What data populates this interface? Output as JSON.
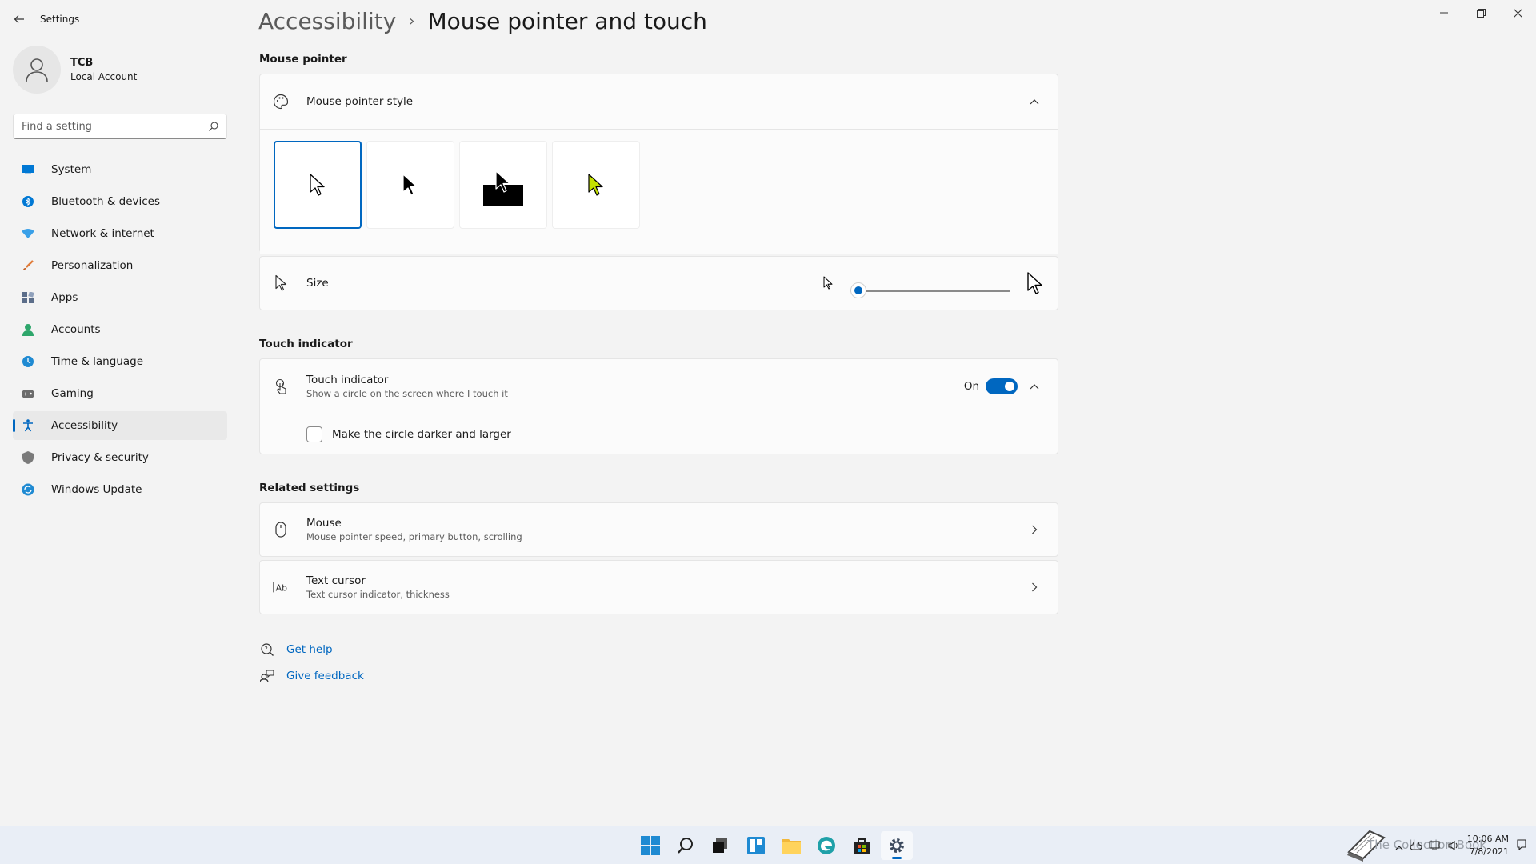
{
  "app": {
    "title": "Settings"
  },
  "user": {
    "name": "TCB",
    "account_type": "Local Account"
  },
  "search": {
    "placeholder": "Find a setting"
  },
  "nav": {
    "items": [
      {
        "label": "System",
        "icon": "monitor-icon",
        "color": "#0078d4"
      },
      {
        "label": "Bluetooth & devices",
        "icon": "bluetooth-icon",
        "color": "#0078d4"
      },
      {
        "label": "Network & internet",
        "icon": "wifi-icon",
        "color": "#3aa0e8"
      },
      {
        "label": "Personalization",
        "icon": "brush-icon",
        "color": "#e07b39"
      },
      {
        "label": "Apps",
        "icon": "apps-icon",
        "color": "#5c6e8a"
      },
      {
        "label": "Accounts",
        "icon": "person-icon",
        "color": "#2ea66b"
      },
      {
        "label": "Time & language",
        "icon": "globe-icon",
        "color": "#1f8ad2"
      },
      {
        "label": "Gaming",
        "icon": "gamepad-icon",
        "color": "#6b6b6b"
      },
      {
        "label": "Accessibility",
        "icon": "accessibility-icon",
        "color": "#0067c0",
        "active": true
      },
      {
        "label": "Privacy & security",
        "icon": "shield-icon",
        "color": "#7a7a7a"
      },
      {
        "label": "Windows Update",
        "icon": "update-icon",
        "color": "#1f8ad2"
      }
    ]
  },
  "breadcrumb": {
    "parent": "Accessibility",
    "current": "Mouse pointer and touch"
  },
  "mouse_pointer": {
    "section_title": "Mouse pointer",
    "style_label": "Mouse pointer style",
    "styles": [
      "white",
      "black",
      "inverted",
      "custom"
    ],
    "custom_color": "#c4e100",
    "size_label": "Size",
    "size_value": 1,
    "size_min": 1,
    "size_max": 15
  },
  "touch": {
    "section_title": "Touch indicator",
    "title": "Touch indicator",
    "subtitle": "Show a circle on the screen where I touch it",
    "state_label": "On",
    "checkbox_label": "Make the circle darker and larger"
  },
  "related": {
    "section_title": "Related settings",
    "items": [
      {
        "title": "Mouse",
        "subtitle": "Mouse pointer speed, primary button, scrolling"
      },
      {
        "title": "Text cursor",
        "subtitle": "Text cursor indicator, thickness"
      }
    ]
  },
  "help": {
    "get_help": "Get help",
    "give_feedback": "Give feedback"
  },
  "taskbar": {
    "time": "10:06 AM",
    "date": "7/8/2021",
    "watermark": "The Collection Book"
  },
  "colors": {
    "accent": "#0067c0"
  }
}
